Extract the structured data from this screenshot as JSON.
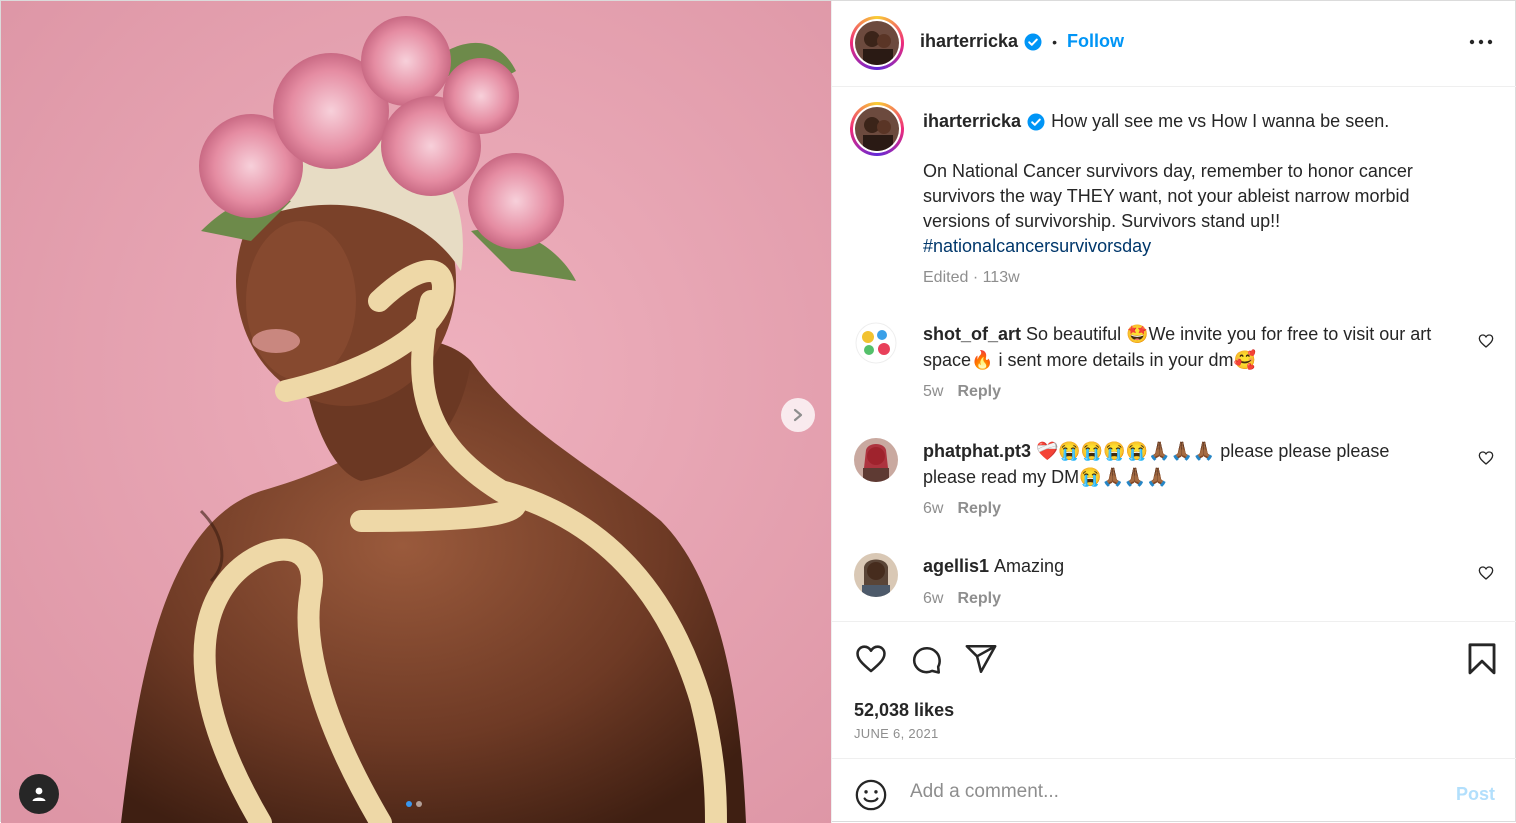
{
  "post": {
    "media": {
      "carousel_dots": 2,
      "active_dot": 0
    },
    "header": {
      "username": "iharterricka",
      "separator": "•",
      "follow_label": "Follow"
    },
    "caption": {
      "username": "iharterricka",
      "line1": "How yall see me vs How I wanna be seen.",
      "body": "On National Cancer survivors day, remember to honor cancer survivors the way THEY want, not your ableist narrow morbid versions of survivorship. Survivors stand up!!",
      "hashtag": "#nationalcancersurvivorsday",
      "meta": "Edited · 113w"
    },
    "comments": [
      {
        "username": "shot_of_art",
        "text": "So beautiful 🤩We invite you for free to visit our art space🔥 i sent more details in your dm🥰",
        "age": "5w",
        "reply_label": "Reply",
        "avatar_label": "SHOT OF ART"
      },
      {
        "username": "phatphat.pt3",
        "text": "❤️‍🩹😭😭😭😭🙏🏾🙏🏾🙏🏾 please please please please read my DM😭🙏🏾🙏🏾🙏🏾",
        "age": "6w",
        "reply_label": "Reply"
      },
      {
        "username": "agellis1",
        "text": "Amazing",
        "age": "6w",
        "reply_label": "Reply"
      }
    ],
    "likes": "52,038 likes",
    "date": "JUNE 6, 2021",
    "add_comment": {
      "placeholder": "Add a comment...",
      "post_label": "Post"
    },
    "colors": {
      "link_blue": "#0095f6",
      "hashtag_blue": "#00376b",
      "muted_gray": "#8e8e8e",
      "post_disabled": "#b2dffc",
      "photo_background": "#e9a5b3"
    },
    "icons": [
      "verified-badge-icon",
      "more-options-icon",
      "carousel-next-icon",
      "user-tag-icon",
      "heart-icon",
      "comment-icon",
      "share-icon",
      "bookmark-icon",
      "emoji-icon"
    ]
  }
}
